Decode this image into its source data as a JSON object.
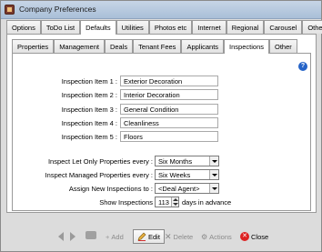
{
  "window": {
    "title": "Company Preferences"
  },
  "tabs_top": [
    "Options",
    "ToDo List",
    "Defaults",
    "Utilities",
    "Photos etc",
    "Internet",
    "Regional",
    "Carousel",
    "Other"
  ],
  "tabs_sub": [
    "Properties",
    "Management",
    "Deals",
    "Tenant Fees",
    "Applicants",
    "Inspections",
    "Other"
  ],
  "inspection_items": [
    {
      "label": "Inspection Item 1 :",
      "value": "Exterior Decoration"
    },
    {
      "label": "Inspection Item 2 :",
      "value": "Interior Decoration"
    },
    {
      "label": "Inspection Item 3 :",
      "value": "General Condition"
    },
    {
      "label": "Inspection Item 4 :",
      "value": "Cleanliness"
    },
    {
      "label": "Inspection Item 5 :",
      "value": "Floors"
    }
  ],
  "settings": {
    "let_only_label": "Inspect Let Only Properties every :",
    "let_only_value": "Six Months",
    "managed_label": "Inspect Managed Properties every :",
    "managed_value": "Six Weeks",
    "assign_label": "Assign New Inspections to :",
    "assign_value": "<Deal Agent>",
    "show_label": "Show Inspections",
    "show_value": "113",
    "show_suffix": "days in advance"
  },
  "toolbar": {
    "add": "Add",
    "edit": "Edit",
    "delete": "Delete",
    "actions": "Actions",
    "close": "Close"
  },
  "icons": {
    "help": "help-icon",
    "prev": "left-arrow-icon",
    "next": "right-arrow-icon",
    "find": "binoculars-icon"
  },
  "colors": {
    "help": "#2563c7",
    "close": "#dd2222"
  }
}
